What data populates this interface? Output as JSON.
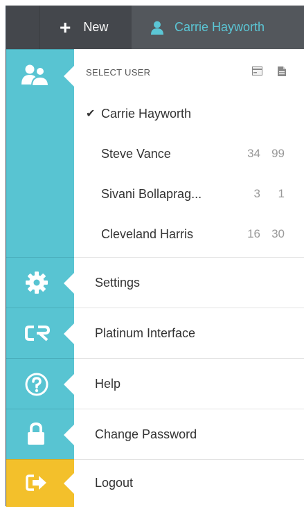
{
  "topbar": {
    "new_label": "New",
    "user_name": "Carrie Hayworth"
  },
  "select_user": {
    "heading": "SELECT USER",
    "users": [
      {
        "name": "Carrie Hayworth",
        "selected": true,
        "count1": "",
        "count2": ""
      },
      {
        "name": "Steve Vance",
        "selected": false,
        "count1": "34",
        "count2": "99"
      },
      {
        "name": "Sivani Bollaprag...",
        "selected": false,
        "count1": "3",
        "count2": "1"
      },
      {
        "name": "Cleveland Harris",
        "selected": false,
        "count1": "16",
        "count2": "30"
      }
    ]
  },
  "menu": {
    "settings": "Settings",
    "platinum": "Platinum Interface",
    "help": "Help",
    "change_password": "Change Password",
    "logout": "Logout"
  },
  "colors": {
    "rail_teal": "#58c4d2",
    "logout_yellow": "#f3c02b",
    "topbar_bg": "#44474c",
    "accent_user": "#5bc6d5"
  },
  "icons": {
    "new": "plus-icon",
    "current_user": "person-icon",
    "users": "users-icon",
    "settings": "gear-icon",
    "platinum": "cr-logo-icon",
    "help": "question-circle-icon",
    "change_password": "lock-icon",
    "logout": "sign-out-icon",
    "sel_a": "card-icon",
    "sel_b": "document-icon"
  }
}
